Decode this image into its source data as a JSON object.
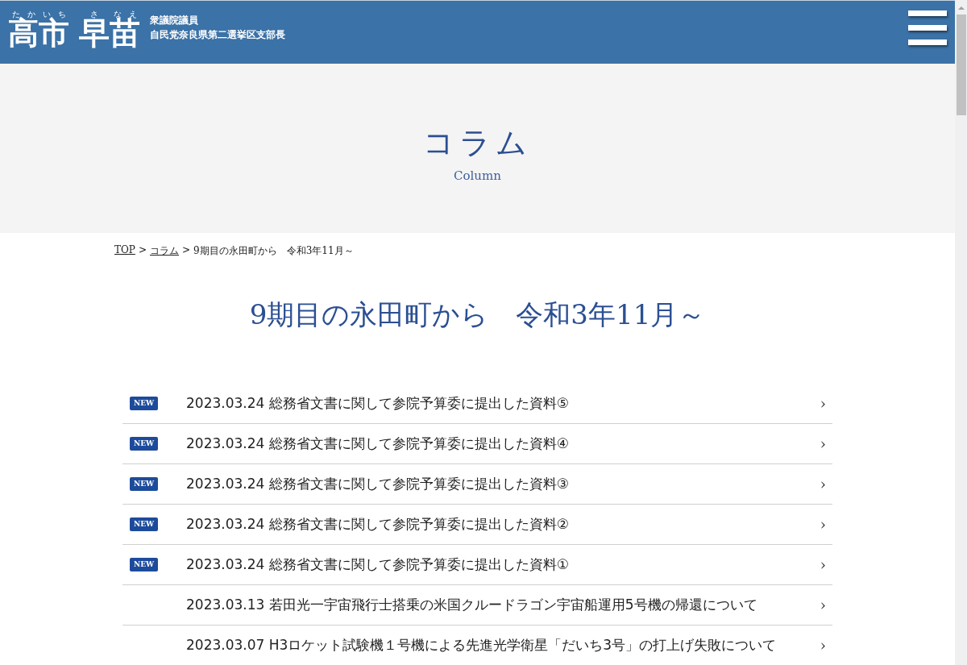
{
  "header": {
    "name": [
      {
        "kanji": "高",
        "ruby": "たか"
      },
      {
        "kanji": "市",
        "ruby": "いち"
      },
      {
        "kanji": "早",
        "ruby": "さ"
      },
      {
        "kanji": "苗",
        "ruby": "なえ"
      }
    ],
    "titles": [
      "衆議院議員",
      "自民党奈良県第二選挙区支部長"
    ]
  },
  "hero": {
    "title": "コラム",
    "subtitle": "Column"
  },
  "breadcrumb": [
    {
      "label": "TOP",
      "link": true
    },
    {
      "label": ">",
      "link": false
    },
    {
      "label": "コラム",
      "link": true
    },
    {
      "label": ">",
      "link": false
    },
    {
      "label": "9期目の永田町から　令和3年11月～",
      "link": false
    }
  ],
  "page_title": "9期目の永田町から　令和3年11月～",
  "articles": [
    {
      "badge": "NEW",
      "text": "2023.03.24 総務省文書に関して参院予算委に提出した資料⑤",
      "chevron": "›"
    },
    {
      "badge": "NEW",
      "text": "2023.03.24 総務省文書に関して参院予算委に提出した資料④",
      "chevron": "›"
    },
    {
      "badge": "NEW",
      "text": "2023.03.24 総務省文書に関して参院予算委に提出した資料③",
      "chevron": "›"
    },
    {
      "badge": "NEW",
      "text": "2023.03.24 総務省文書に関して参院予算委に提出した資料②",
      "chevron": "›"
    },
    {
      "badge": "NEW",
      "text": "2023.03.24 総務省文書に関して参院予算委に提出した資料①",
      "chevron": "›"
    },
    {
      "text": "2023.03.13 若田光一宇宙飛行士搭乗の米国クルードラゴン宇宙船運用5号機の帰還について",
      "chevron": "›"
    },
    {
      "text": "2023.03.07 H3ロケット試験機１号機による先進光学衛星「だいち3号」の打上げ失敗について",
      "chevron": "›"
    }
  ]
}
